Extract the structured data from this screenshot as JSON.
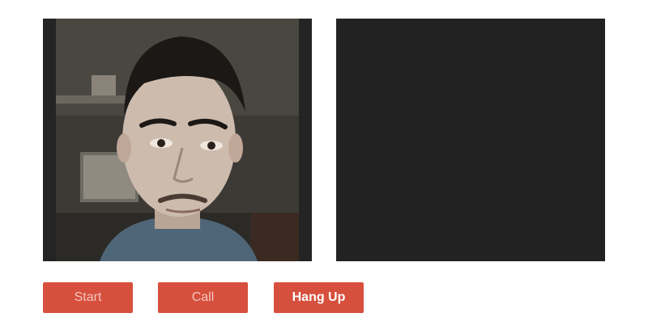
{
  "videos": {
    "local": {
      "description_icon": "webcam-person-icon",
      "state": "streaming"
    },
    "remote": {
      "state": "empty"
    }
  },
  "controls": {
    "start_label": "Start",
    "call_label": "Call",
    "hangup_label": "Hang Up"
  },
  "colors": {
    "button_bg": "#d7503d",
    "button_text_disabled": "#f3c6bf",
    "button_text_enabled": "#ffffff",
    "video_bg": "#222222"
  }
}
